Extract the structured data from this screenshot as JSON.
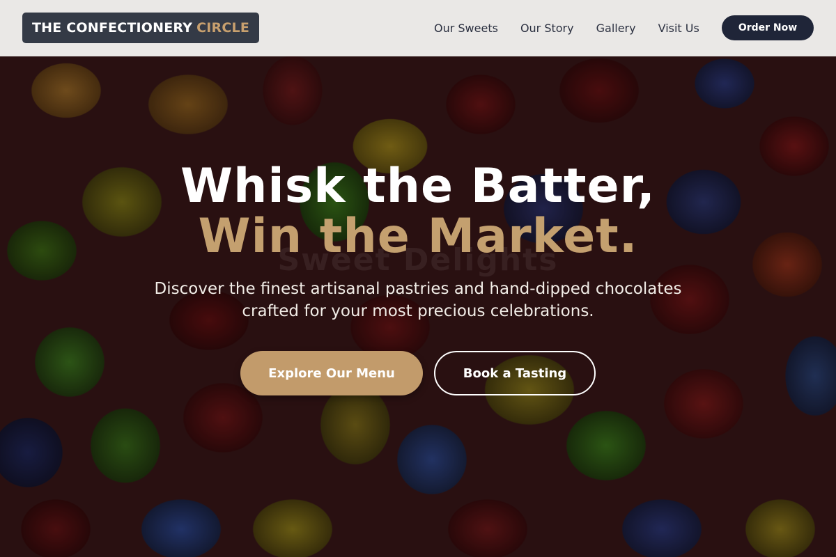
{
  "brand": {
    "name_main": "THE CONFECTIONERY",
    "name_accent": "CIRCLE",
    "accent_color": "#c8a06e"
  },
  "nav": {
    "items": [
      {
        "label": "Our Sweets"
      },
      {
        "label": "Our Story"
      },
      {
        "label": "Gallery"
      },
      {
        "label": "Visit Us"
      }
    ],
    "cta_label": "Order Now"
  },
  "hero": {
    "headline_line1": "Whisk the Batter,",
    "headline_line2": "Win the Market.",
    "watermark": "Sweet Delights",
    "subtitle": "Discover the finest artisanal pastries and hand-dipped chocolates crafted for your most precious celebrations.",
    "primary_button": "Explore Our Menu",
    "secondary_button": "Book a Tasting",
    "background_image": "gummy-bears-photo"
  },
  "colors": {
    "navbar_bg": "#f3f1ef",
    "logo_bg": "#343a46",
    "cta_bg": "#1f2538",
    "primary_button_bg": "#c29b6b",
    "headline_accent": "#c4a06f"
  }
}
